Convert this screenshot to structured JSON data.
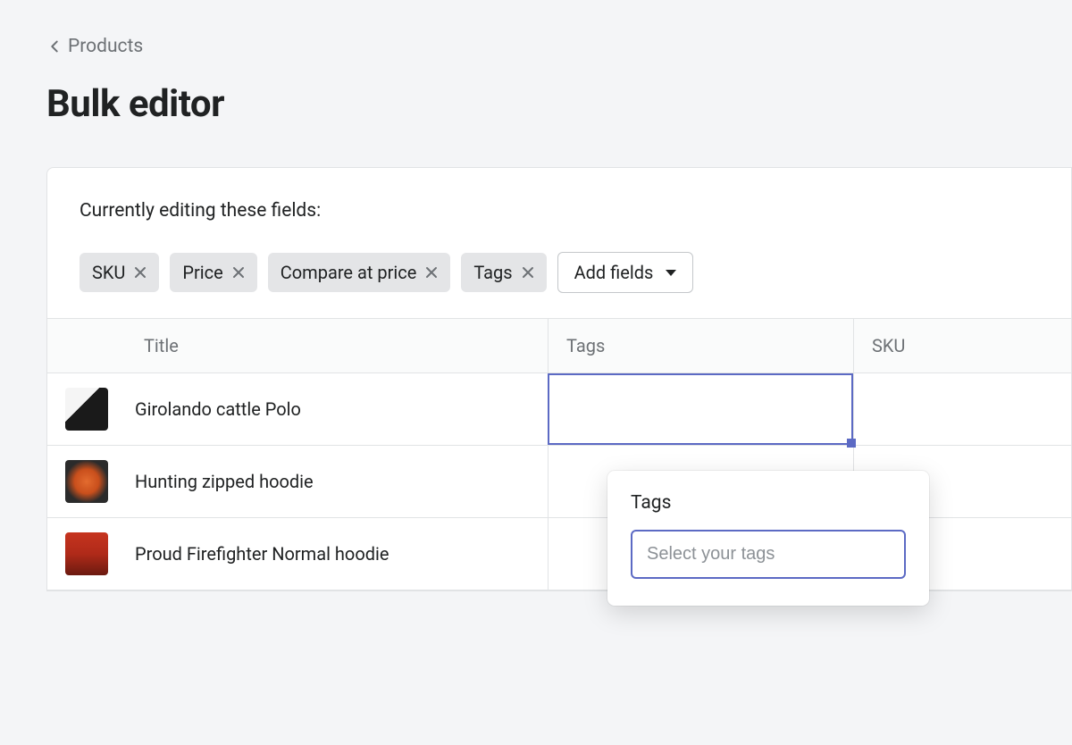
{
  "breadcrumb": {
    "label": "Products"
  },
  "page": {
    "title": "Bulk editor"
  },
  "editing": {
    "label": "Currently editing these fields:",
    "fields": [
      "SKU",
      "Price",
      "Compare at price",
      "Tags"
    ],
    "add_fields_label": "Add fields"
  },
  "table": {
    "headers": {
      "title": "Title",
      "tags": "Tags",
      "sku": "SKU"
    },
    "rows": [
      {
        "title": "Girolando cattle Polo",
        "tags": "",
        "sku": ""
      },
      {
        "title": "Hunting zipped hoodie",
        "tags": "",
        "sku": ""
      },
      {
        "title": "Proud Firefighter Normal hoodie",
        "tags": "",
        "sku": ""
      }
    ]
  },
  "popover": {
    "label": "Tags",
    "placeholder": "Select your tags"
  }
}
